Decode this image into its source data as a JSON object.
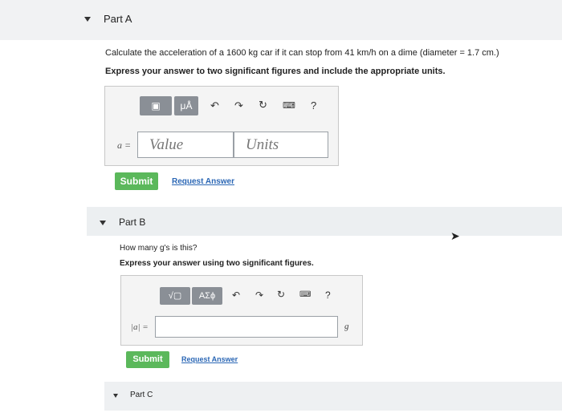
{
  "part_a": {
    "title": "Part A",
    "question": "Calculate the acceleration of a 1600 kg car if it can stop from 41 km/h on a dime (diameter = 1.7 cm.)",
    "instruction": "Express your answer to two significant figures and include the appropriate units.",
    "toolbar": {
      "templates_icon": "matrix-template-icon",
      "units_label": "μÅ",
      "help_label": "?"
    },
    "var_label": "a =",
    "value_placeholder": "Value",
    "units_placeholder": "Units",
    "submit_label": "Submit",
    "request_answer_label": "Request Answer"
  },
  "part_b": {
    "title": "Part B",
    "question": "How many g's is this?",
    "instruction": "Express your answer using two significant figures.",
    "toolbar": {
      "greek_label": "ΑΣϕ",
      "help_label": "?"
    },
    "var_label": "|a| =",
    "unit_suffix": "g",
    "submit_label": "Submit",
    "request_answer_label": "Request Answer"
  },
  "part_c": {
    "title": "Part C"
  },
  "colors": {
    "submit_green": "#5bb85b",
    "link_blue": "#2b67b5",
    "toolbar_gray": "#8a8f96"
  }
}
